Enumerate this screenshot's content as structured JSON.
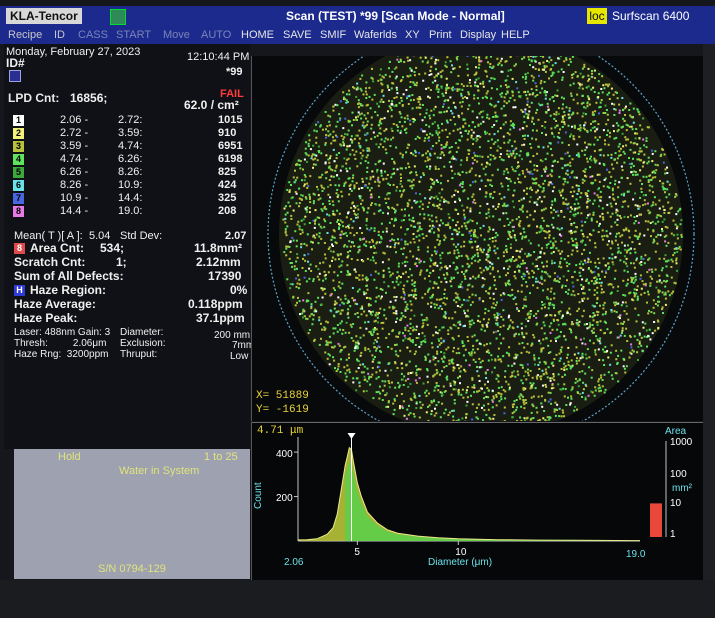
{
  "window": {
    "app_badge": "KLA-Tencor",
    "title": "Scan (TEST)  *99 [Scan Mode - Normal]",
    "loc_label": "loc",
    "product": "Surfscan 6400"
  },
  "menu": [
    "Recipe",
    "ID",
    "CASS",
    "START",
    "Move",
    "AUTO",
    "HOME",
    "SAVE",
    "SMIF",
    "Waferlds",
    "XY",
    "Print",
    "Display",
    "HELP"
  ],
  "header": {
    "date": "Monday, February 27, 2023",
    "time": "12:10:44 PM",
    "id_label": "ID#",
    "wafer_id": "*99"
  },
  "lpd": {
    "label": "LPD Cnt:",
    "count": "16856;",
    "status": "FAIL",
    "density": "62.0 / cm²",
    "bins": [
      {
        "num": "1",
        "lo": "2.06 -",
        "hi": "2.72:",
        "count": "1015",
        "color": "#ffffff"
      },
      {
        "num": "2",
        "lo": "2.72 -",
        "hi": "3.59:",
        "count": "910",
        "color": "#f2f27a"
      },
      {
        "num": "3",
        "lo": "3.59 -",
        "hi": "4.74:",
        "count": "6951",
        "color": "#b8c23a"
      },
      {
        "num": "4",
        "lo": "4.74 -",
        "hi": "6.26:",
        "count": "6198",
        "color": "#5ee35e"
      },
      {
        "num": "5",
        "lo": "6.26 -",
        "hi": "8.26:",
        "count": "825",
        "color": "#3aa83a"
      },
      {
        "num": "6",
        "lo": "8.26 -",
        "hi": "10.9:",
        "count": "424",
        "color": "#6ae0e8"
      },
      {
        "num": "7",
        "lo": "10.9 -",
        "hi": "14.4:",
        "count": "325",
        "color": "#4a66e0"
      },
      {
        "num": "8",
        "lo": "14.4 -",
        "hi": "19.0:",
        "count": "208",
        "color": "#e87ae8"
      }
    ],
    "mean_label": "Mean( T )[ A ]:",
    "mean": "5.04",
    "stddev_label": "Std Dev:",
    "stddev": "2.07"
  },
  "stats": {
    "area_icon": "8",
    "area_label": "Area Cnt:",
    "area_count": "534;",
    "area_value": "11.8mm²",
    "scratch_label": "Scratch Cnt:",
    "scratch_count": "1;",
    "scratch_value": "2.12mm",
    "sum_label": "Sum of All Defects:",
    "sum_value": "17390",
    "haze_icon": "H",
    "haze_region_label": "Haze Region:",
    "haze_region_value": "0%",
    "haze_avg_label": "Haze Average:",
    "haze_avg_value": "0.118ppm",
    "haze_peak_label": "Haze Peak:",
    "haze_peak_value": "37.1ppm"
  },
  "params": {
    "laser": "Laser: 488nm Gain: 3",
    "diameter_label": "Diameter:",
    "diameter_value": "200 mm",
    "thresh": "Thresh:         2.06μm",
    "exclusion_label": "Exclusion:",
    "exclusion_value": "7mm",
    "haze_rng": "Haze Rng:  3200ppm",
    "thruput_label": "Thruput:",
    "thruput_value": "Low"
  },
  "status": {
    "state": "Hold",
    "range": "1 to 25",
    "message": "Water in System",
    "serial": "S/N   0794-129"
  },
  "map": {
    "x_readout": "X=   51889",
    "y_readout": "Y=   -1619"
  },
  "histogram": {
    "cursor_value": "4.71  μm",
    "y_title": "Count",
    "y_ticks": [
      "400",
      "200"
    ],
    "x_title": "Diameter (μm)",
    "x_min": "2.06",
    "x_ticks": [
      "5",
      "10"
    ],
    "x_max": "19.0",
    "area_title": "Area",
    "area_ticks": [
      "1000",
      "100",
      "10",
      "1"
    ],
    "area_unit": "mm²",
    "area_bar_level": 0.35
  },
  "chart_data": {
    "type": "area",
    "title": "",
    "xlabel": "Diameter (μm)",
    "ylabel": "Count",
    "xlim": [
      2.06,
      19.0
    ],
    "ylim": [
      0,
      450
    ],
    "x": [
      2.06,
      2.5,
      3.0,
      3.5,
      3.8,
      4.0,
      4.2,
      4.4,
      4.5,
      4.6,
      4.71,
      4.8,
      5.0,
      5.2,
      5.5,
      6.0,
      6.5,
      7.0,
      8.0,
      9.0,
      10.0,
      12.0,
      14.0,
      16.0,
      19.0
    ],
    "series": [
      {
        "values": [
          5,
          6,
          10,
          30,
          60,
          120,
          230,
          340,
          380,
          420,
          410,
          360,
          260,
          200,
          130,
          80,
          50,
          35,
          22,
          15,
          10,
          6,
          4,
          3,
          2
        ]
      }
    ],
    "grid": false
  }
}
